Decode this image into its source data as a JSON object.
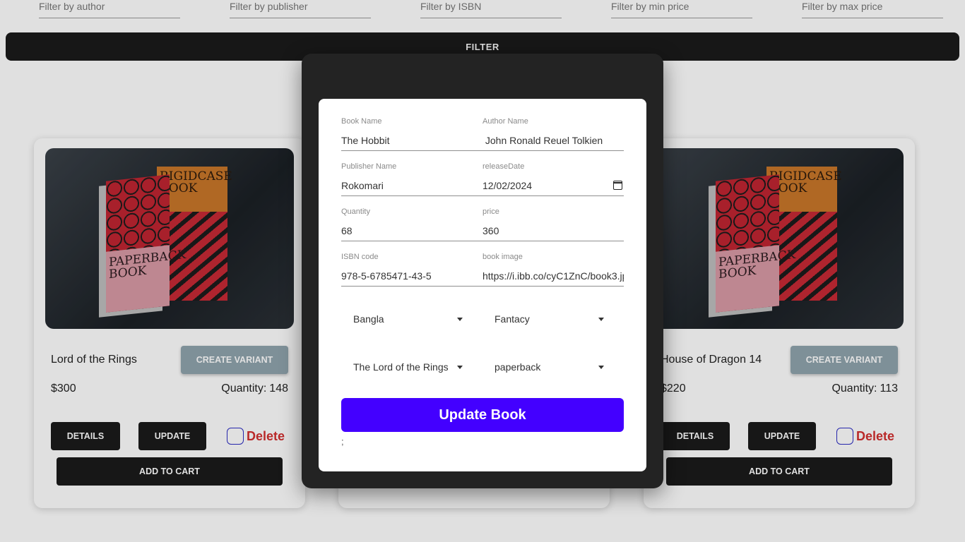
{
  "filters": {
    "author_placeholder": "Filter by author",
    "publisher_placeholder": "Filter by publisher",
    "isbn_placeholder": "Filter by ISBN",
    "min_price_placeholder": "Filter by min price",
    "max_price_placeholder": "Filter by max price",
    "filter_button": "FILTER"
  },
  "cards": [
    {
      "title": "Lord of the Rings",
      "price": "$300",
      "quantity_label": "Quantity:",
      "quantity": "148",
      "create_variant": "CREATE VARIANT",
      "details": "DETAILS",
      "update": "UPDATE",
      "delete": "Delete",
      "add_to_cart": "ADD TO CART",
      "cover_text": {
        "back": "RIGIDCASE BOOK",
        "front": "PAPERBACK BOOK"
      }
    },
    {
      "title": "House of Dragon 14",
      "price": "$220",
      "quantity_label": "Quantity:",
      "quantity": "113",
      "create_variant": "CREATE VARIANT",
      "details": "DETAILS",
      "update": "UPDATE",
      "delete": "Delete",
      "add_to_cart": "ADD TO CART",
      "cover_text": {
        "back": "RIGIDCASE BOOK",
        "front": "PAPERBACK BOOK"
      }
    }
  ],
  "modal": {
    "book_name": {
      "label": "Book Name",
      "value": "The Hobbit"
    },
    "author_name": {
      "label": "Author Name",
      "value": " John Ronald Reuel Tolkien"
    },
    "publisher_name": {
      "label": "Publisher Name",
      "value": "Rokomari"
    },
    "release_date": {
      "label": "releaseDate",
      "value": "12/02/2024"
    },
    "quantity": {
      "label": "Quantity",
      "value": "68"
    },
    "price": {
      "label": "price",
      "value": "360"
    },
    "isbn": {
      "label": "ISBN code",
      "value": "978-5-6785471-43-5"
    },
    "book_image": {
      "label": "book image",
      "value": "https://i.ibb.co/cyC1ZnC/book3.jpg"
    },
    "language_select": "Bangla",
    "genre_select": "Fantacy",
    "series_select": "The Lord of the Rings",
    "format_select": "paperback",
    "submit_button": "Update Book",
    "trailing_text": ";"
  },
  "colors": {
    "accent": "#4300ff",
    "delete": "#d32f2f",
    "variant_button": "#90a4ae",
    "dark_button": "#1b1b1b",
    "modal_frame": "#232323"
  }
}
